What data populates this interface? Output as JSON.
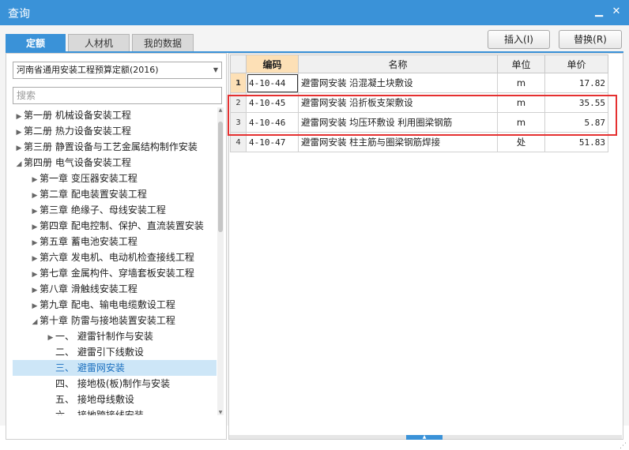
{
  "window": {
    "title": "查询",
    "minimize_glyph": "▁",
    "close_glyph": "✕"
  },
  "tabs": [
    {
      "label": "定额",
      "active": true
    },
    {
      "label": "人材机",
      "active": false
    },
    {
      "label": "我的数据",
      "active": false
    }
  ],
  "actions": {
    "insert_label": "插入(I)",
    "replace_label": "替换(R)"
  },
  "left": {
    "library_select": "河南省通用安装工程预算定额(2016)",
    "search_placeholder": "搜索",
    "tree": [
      {
        "label": "第一册  机械设备安装工程",
        "level": 0,
        "expanded": false
      },
      {
        "label": "第二册  热力设备安装工程",
        "level": 0,
        "expanded": false
      },
      {
        "label": "第三册  静置设备与工艺金属结构制作安装",
        "level": 0,
        "expanded": false
      },
      {
        "label": "第四册  电气设备安装工程",
        "level": 0,
        "expanded": true
      },
      {
        "label": "第一章  变压器安装工程",
        "level": 1,
        "expanded": false
      },
      {
        "label": "第二章  配电装置安装工程",
        "level": 1,
        "expanded": false
      },
      {
        "label": "第三章  绝缘子、母线安装工程",
        "level": 1,
        "expanded": false
      },
      {
        "label": "第四章  配电控制、保护、直流装置安装",
        "level": 1,
        "expanded": false
      },
      {
        "label": "第五章  蓄电池安装工程",
        "level": 1,
        "expanded": false
      },
      {
        "label": "第六章  发电机、电动机检查接线工程",
        "level": 1,
        "expanded": false
      },
      {
        "label": "第七章  金属构件、穿墙套板安装工程",
        "level": 1,
        "expanded": false
      },
      {
        "label": "第八章  滑触线安装工程",
        "level": 1,
        "expanded": false
      },
      {
        "label": "第九章  配电、输电电缆敷设工程",
        "level": 1,
        "expanded": false
      },
      {
        "label": "第十章  防雷与接地装置安装工程",
        "level": 1,
        "expanded": true
      },
      {
        "label": "一、  避雷针制作与安装",
        "level": 2,
        "expanded": false
      },
      {
        "label": "二、  避雷引下线敷设",
        "level": 2,
        "leaf": true
      },
      {
        "label": "三、  避雷网安装",
        "level": 2,
        "leaf": true,
        "selected": true
      },
      {
        "label": "四、  接地极(板)制作与安装",
        "level": 2,
        "leaf": true
      },
      {
        "label": "五、  接地母线敷设",
        "level": 2,
        "leaf": true
      },
      {
        "label": "六、  接地跨接线安装",
        "level": 2,
        "leaf": true
      }
    ]
  },
  "grid": {
    "columns": [
      "编码",
      "名称",
      "单位",
      "单价"
    ],
    "rows": [
      {
        "num": "1",
        "code": "4-10-44",
        "name": "避雷网安装 沿混凝土块敷设",
        "unit": "m",
        "price": "17.82"
      },
      {
        "num": "2",
        "code": "4-10-45",
        "name": "避雷网安装 沿折板支架敷设",
        "unit": "m",
        "price": "35.55"
      },
      {
        "num": "3",
        "code": "4-10-46",
        "name": "避雷网安装 均压环敷设 利用圈梁钢筋",
        "unit": "m",
        "price": "5.87"
      },
      {
        "num": "4",
        "code": "4-10-47",
        "name": "避雷网安装 柱主筋与圈梁钢筋焊接",
        "unit": "处",
        "price": "51.83"
      }
    ]
  },
  "colors": {
    "accent": "#3a92d8",
    "highlight_border": "#e53030",
    "header_sorted": "#fde0b6",
    "selected_row": "#cde6f7"
  }
}
